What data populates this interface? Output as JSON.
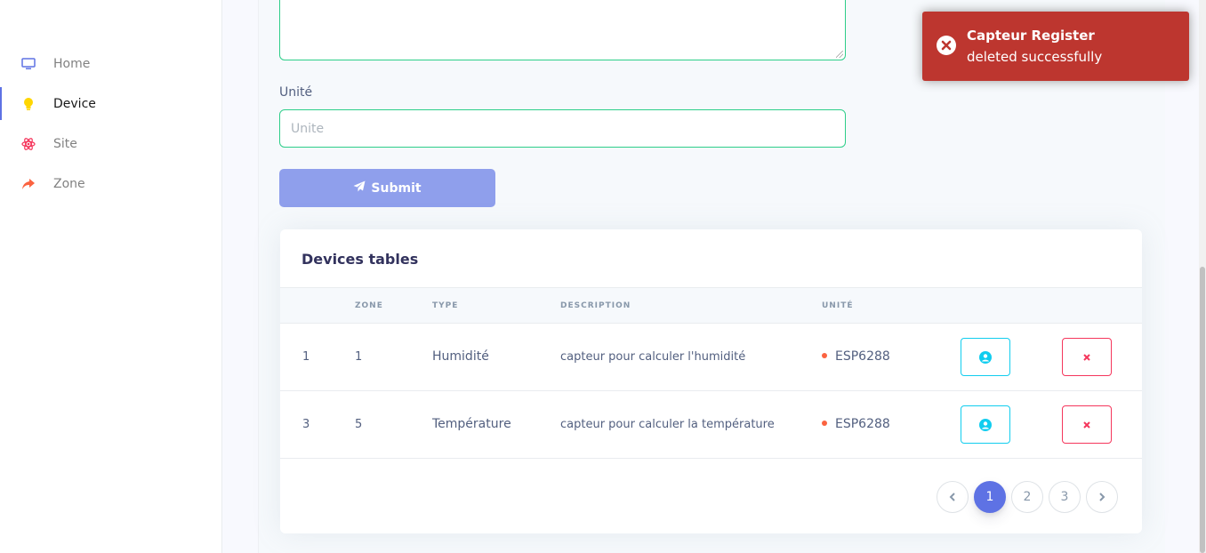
{
  "sidebar": {
    "items": [
      {
        "label": "Home",
        "icon": "tv-icon",
        "color": "#5e72e4"
      },
      {
        "label": "Device",
        "icon": "bulb-icon",
        "color": "#ffd600",
        "active": true
      },
      {
        "label": "Site",
        "icon": "atom-icon",
        "color": "#f5365c"
      },
      {
        "label": "Zone",
        "icon": "share-icon",
        "color": "#fb6340"
      }
    ]
  },
  "form": {
    "unite_label": "Unité",
    "unite_placeholder": "Unite",
    "submit_label": "Submit"
  },
  "table": {
    "title": "Devices tables",
    "headers": [
      "",
      "ZONE",
      "TYPE",
      "DESCRIPTION",
      "UNITÉ"
    ],
    "rows": [
      {
        "id": "1",
        "zone": "1",
        "type": "Humidité",
        "description": "capteur pour calculer l'humidité",
        "unite": "ESP6288"
      },
      {
        "id": "3",
        "zone": "5",
        "type": "Température",
        "description": "capteur pour calculer la température",
        "unite": "ESP6288"
      }
    ]
  },
  "pagination": {
    "pages": [
      "1",
      "2",
      "3"
    ],
    "current": "1"
  },
  "toast": {
    "title": "Capteur Register",
    "message": "deleted successfully",
    "color": "#bd362f"
  },
  "colors": {
    "accent": "#5e72e4",
    "success_border": "#2dce89",
    "info": "#11cdef",
    "danger": "#f5365c",
    "dot": "#fb6340"
  }
}
